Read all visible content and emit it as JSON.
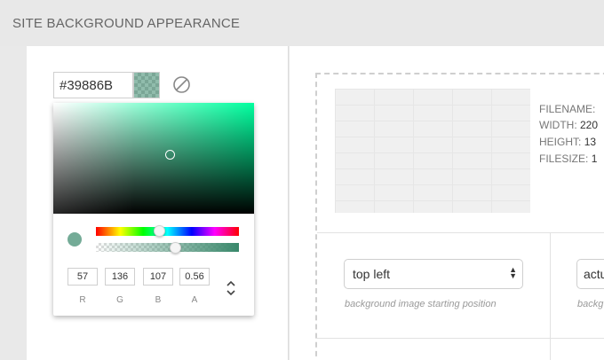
{
  "header": {
    "title": "SITE BACKGROUND APPEARANCE"
  },
  "color": {
    "hex_value": "#39886B",
    "swatch_color": "#39886B",
    "picker": {
      "r": "57",
      "g": "136",
      "b": "107",
      "a": "0.56",
      "labels": {
        "r": "R",
        "g": "G",
        "b": "B",
        "a": "A"
      },
      "alpha": 0.56
    }
  },
  "image": {
    "meta": [
      {
        "key": "FILENAME:",
        "value": ""
      },
      {
        "key": "WIDTH:",
        "value": "220"
      },
      {
        "key": "HEIGHT:",
        "value": "13"
      },
      {
        "key": "FILESIZE:",
        "value": "1"
      }
    ]
  },
  "position": {
    "selected": "top left",
    "hint": "background image starting position"
  },
  "attachment": {
    "selected": "actu",
    "hint": "backg"
  },
  "icons": {
    "clear": "no-color-icon",
    "mode_toggle": "chevron-up-down-icon",
    "select_arrow": "select-arrow-icon"
  }
}
